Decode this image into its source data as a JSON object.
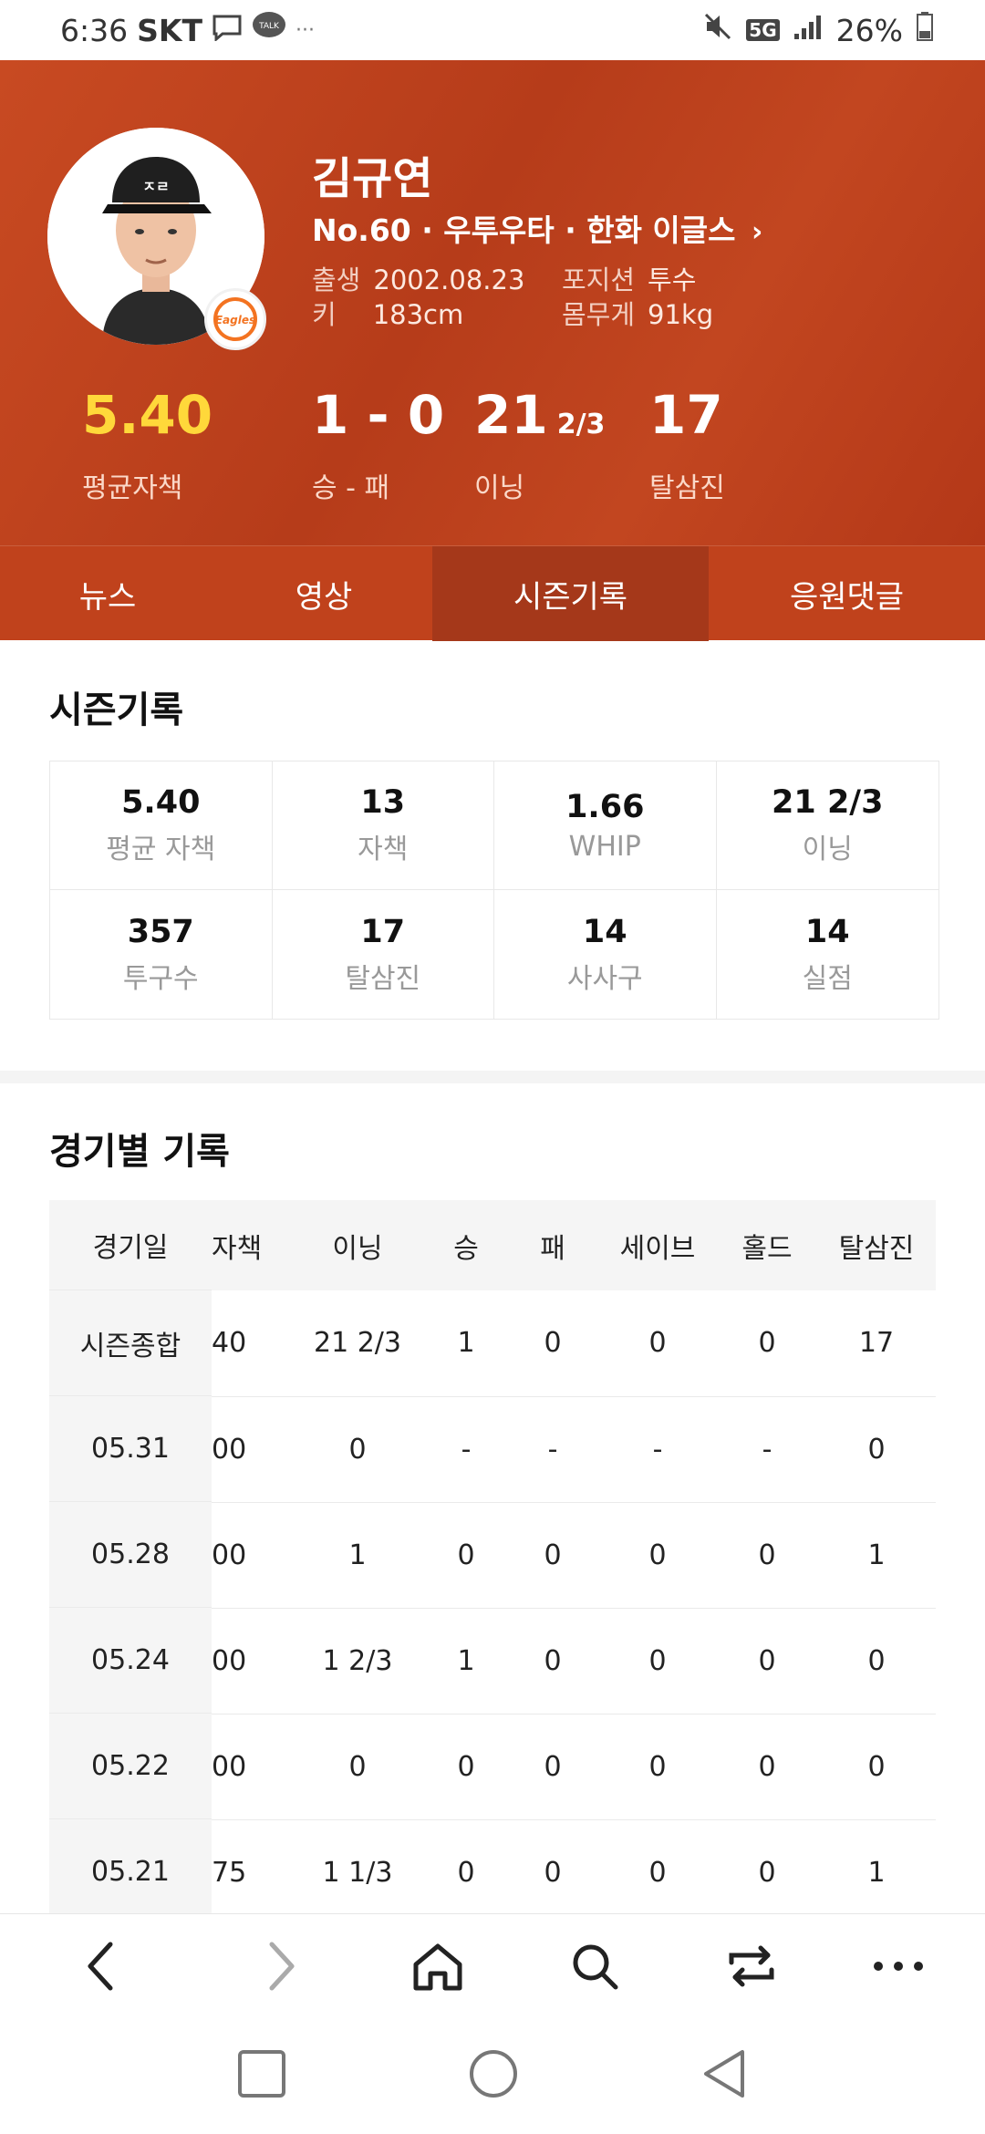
{
  "status": {
    "time": "6:36",
    "carrier": "SKT",
    "battery": "26%",
    "network": "5G"
  },
  "player": {
    "name": "김규연",
    "team_line": "No.60 · 우투우타 · 한화 이글스",
    "birth_label": "출생",
    "birth": "2002.08.23",
    "position_label": "포지션",
    "position": "투수",
    "height_label": "키",
    "height": "183cm",
    "weight_label": "몸무게",
    "weight": "91kg",
    "logo_text": "Eagles"
  },
  "hero_stats": [
    {
      "value": "5.40",
      "label": "평균자책"
    },
    {
      "value": "1 - 0",
      "label": "승 - 패"
    },
    {
      "value": "21",
      "sub": "2/3",
      "label": "이닝"
    },
    {
      "value": "17",
      "label": "탈삼진"
    }
  ],
  "tabs": [
    "뉴스",
    "영상",
    "시즌기록",
    "응원댓글"
  ],
  "active_tab": "시즌기록",
  "season": {
    "title": "시즌기록",
    "cells": [
      {
        "value": "5.40",
        "label": "평균 자책"
      },
      {
        "value": "13",
        "label": "자책"
      },
      {
        "value": "1.66",
        "label": "WHIP"
      },
      {
        "value": "21 2/3",
        "label": "이닝"
      },
      {
        "value": "357",
        "label": "투구수"
      },
      {
        "value": "17",
        "label": "탈삼진"
      },
      {
        "value": "14",
        "label": "사사구"
      },
      {
        "value": "14",
        "label": "실점"
      }
    ]
  },
  "games": {
    "title": "경기별 기록",
    "date_header": "경기일",
    "headers": [
      "자책",
      "이닝",
      "승",
      "패",
      "세이브",
      "홀드",
      "탈삼진"
    ],
    "rows": [
      {
        "date": "시즌종합",
        "cells": [
          "40",
          "21 2/3",
          "1",
          "0",
          "0",
          "0",
          "17"
        ]
      },
      {
        "date": "05.31",
        "cells": [
          "00",
          "0",
          "-",
          "-",
          "-",
          "-",
          "0"
        ]
      },
      {
        "date": "05.28",
        "cells": [
          "00",
          "1",
          "0",
          "0",
          "0",
          "0",
          "1"
        ]
      },
      {
        "date": "05.24",
        "cells": [
          "00",
          "1 2/3",
          "1",
          "0",
          "0",
          "0",
          "0"
        ]
      },
      {
        "date": "05.22",
        "cells": [
          "00",
          "0",
          "0",
          "0",
          "0",
          "0",
          "0"
        ]
      },
      {
        "date": "05.21",
        "cells": [
          "75",
          "1 1/3",
          "0",
          "0",
          "0",
          "0",
          "1"
        ]
      }
    ]
  },
  "colors": {
    "accent": "#c0421c",
    "era_highlight": "#ffd83a"
  }
}
